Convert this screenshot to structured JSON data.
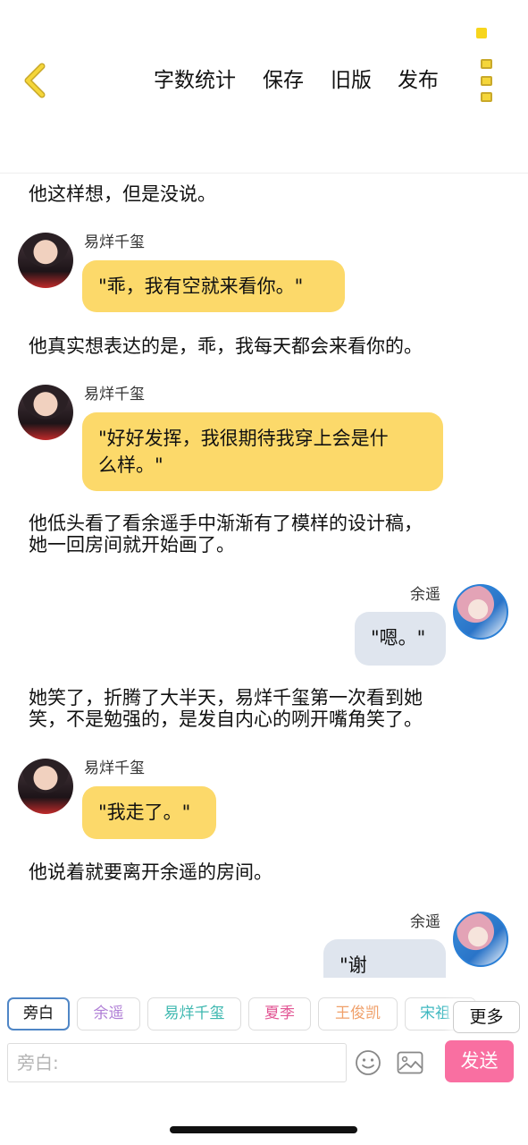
{
  "header": {
    "back_icon": "chevron-left-icon",
    "nav": [
      {
        "label": "字数统计"
      },
      {
        "label": "保存"
      },
      {
        "label": "旧版"
      },
      {
        "label": "发布"
      }
    ],
    "more_icon": "vertical-dots-icon",
    "accent_color": "#f5d63a"
  },
  "messages": [
    {
      "type": "narration",
      "text": "他这样想，但是没说。"
    },
    {
      "type": "bubble",
      "side": "left",
      "speaker": "易烊千玺",
      "text": "\"乖，我有空就来看你。\""
    },
    {
      "type": "narration",
      "text": "他真实想表达的是，乖，我每天都会来看你的。"
    },
    {
      "type": "bubble",
      "side": "left",
      "speaker": "易烊千玺",
      "lines": [
        "\"好好发挥，我很期待我穿上会是什",
        "么样。\""
      ]
    },
    {
      "type": "narration",
      "lines": [
        "他低头看了看余遥手中渐渐有了模样的设计稿，",
        "她一回房间就开始画了。"
      ]
    },
    {
      "type": "bubble",
      "side": "right",
      "speaker": "余遥",
      "text": "\"嗯。\""
    },
    {
      "type": "narration",
      "lines": [
        "她笑了，折腾了大半天，易烊千玺第一次看到她",
        "笑，不是勉强的，是发自内心的咧开嘴角笑了。"
      ]
    },
    {
      "type": "bubble",
      "side": "left",
      "speaker": "易烊千玺",
      "text": "\"我走了。\""
    },
    {
      "type": "narration",
      "text": "他说着就要离开余遥的房间。"
    },
    {
      "type": "bubble",
      "side": "right",
      "speaker": "余遥",
      "text": "\"谢谢......\""
    }
  ],
  "chips": [
    {
      "label": "旁白",
      "color": "#111111"
    },
    {
      "label": "余遥",
      "color": "#b07fd6"
    },
    {
      "label": "易烊千玺",
      "color": "#3fb8b0"
    },
    {
      "label": "夏季",
      "color": "#e25694"
    },
    {
      "label": "王俊凯",
      "color": "#f0a06a"
    },
    {
      "label": "宋祖",
      "color": "#3fb8c0"
    }
  ],
  "chips_more_label": "更多",
  "input": {
    "placeholder": "旁白:",
    "value": ""
  },
  "send_label": "发送",
  "send_color": "#f96fa1"
}
